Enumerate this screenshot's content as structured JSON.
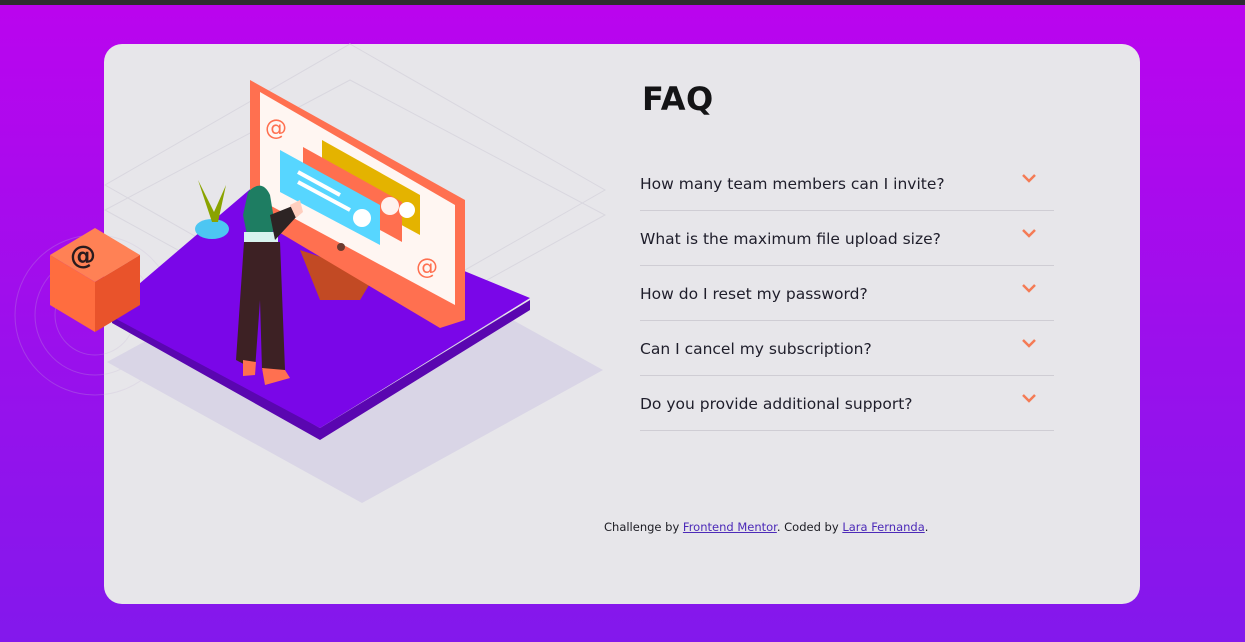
{
  "faq": {
    "title": "FAQ",
    "questions": [
      {
        "label": "How many team members can I invite?"
      },
      {
        "label": "What is the maximum file upload size?"
      },
      {
        "label": "How do I reset my password?"
      },
      {
        "label": "Can I cancel my subscription?"
      },
      {
        "label": "Do you provide additional support?"
      }
    ]
  },
  "attribution": {
    "prefix": "Challenge by",
    "link1": "Frontend Mentor",
    "middle": ". Coded by",
    "link2": "Lara Fernanda",
    "suffix": "."
  },
  "illustration": {
    "icon": "woman-online-illustration",
    "box_symbol": "@"
  },
  "colors": {
    "accent": "#f47b56",
    "gradient_top": "#bb04ee",
    "gradient_bottom": "#8318ec",
    "card": "#e7e6ea"
  }
}
